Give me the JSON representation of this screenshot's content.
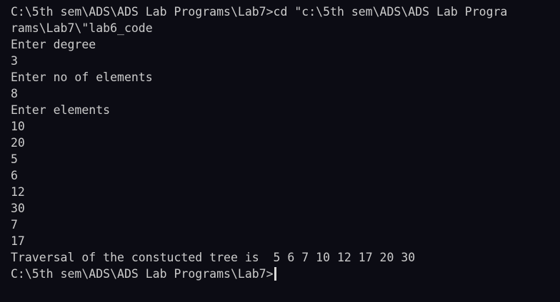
{
  "terminal": {
    "lines": [
      "C:\\5th sem\\ADS\\ADS Lab Programs\\Lab7>cd \"c:\\5th sem\\ADS\\ADS Lab Progra",
      "rams\\Lab7\\\"lab6_code",
      "Enter degree",
      "3",
      "Enter no of elements",
      "8",
      "Enter elements",
      "10",
      "20",
      "5",
      "6",
      "12",
      "30",
      "7",
      "17",
      "Traversal of the constucted tree is  5 6 7 10 12 17 20 30"
    ],
    "prompt": "C:\\5th sem\\ADS\\ADS Lab Programs\\Lab7>"
  },
  "colors": {
    "background": "#0c0c14",
    "text": "#cccccc",
    "cursor": "#d9d9d9"
  }
}
